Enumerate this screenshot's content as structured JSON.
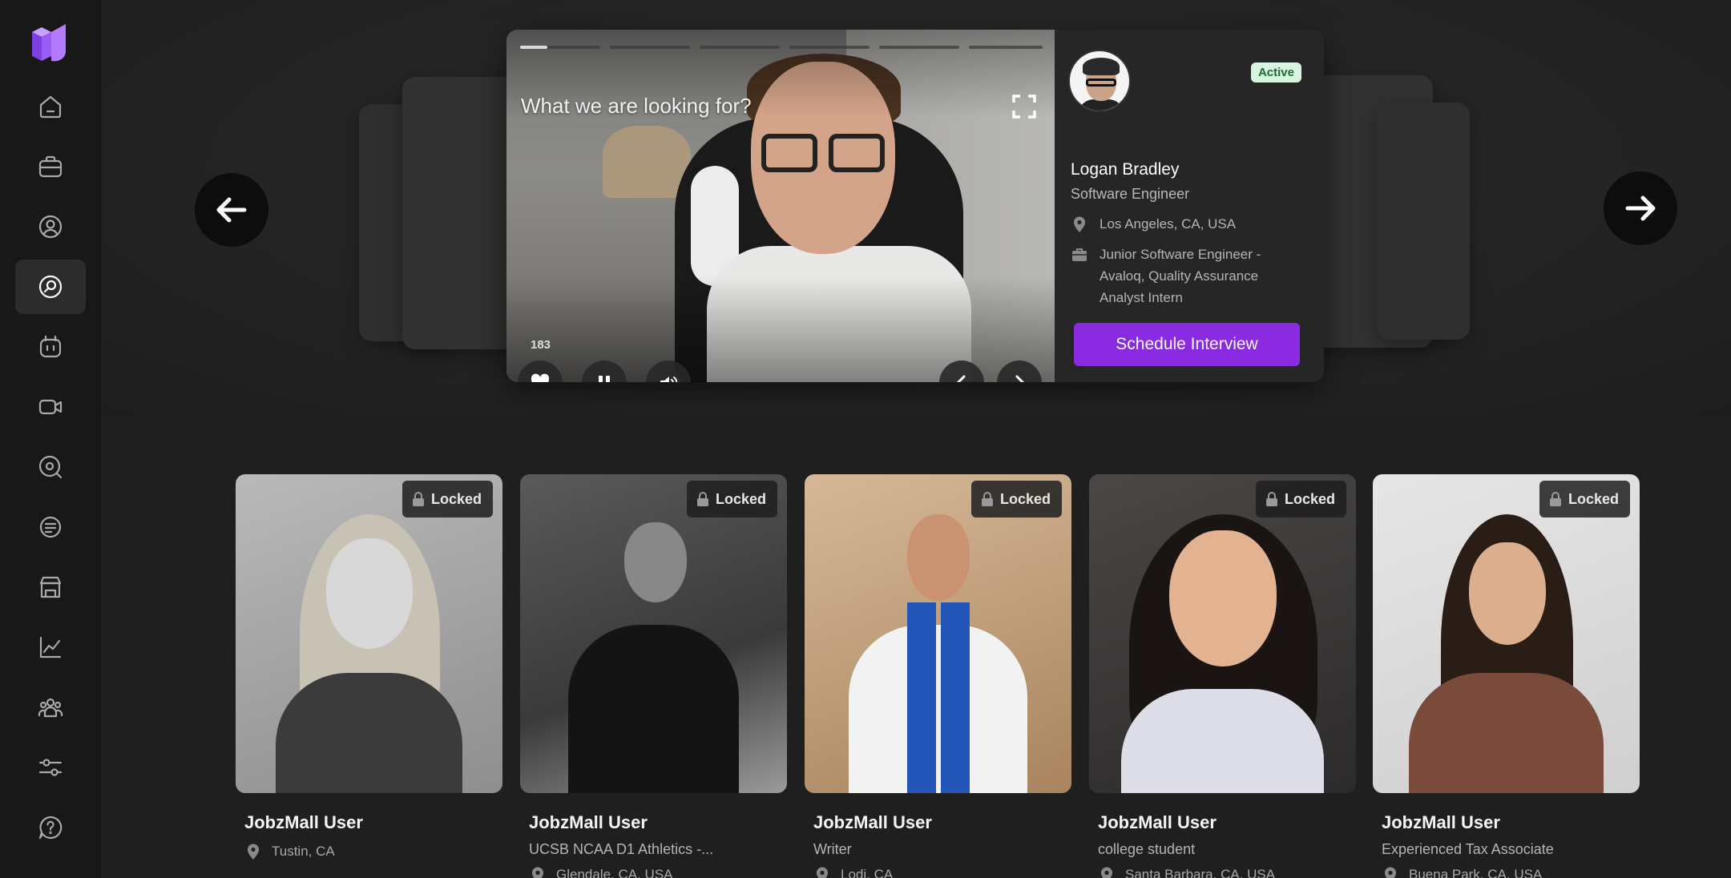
{
  "sidebar": {
    "items": [
      {
        "icon": "home-icon",
        "active": false
      },
      {
        "icon": "briefcase-icon",
        "active": false
      },
      {
        "icon": "user-circle-icon",
        "active": false
      },
      {
        "icon": "search-icon",
        "active": true
      },
      {
        "icon": "calendar-icon",
        "active": false
      },
      {
        "icon": "video-icon",
        "active": false
      },
      {
        "icon": "search-analytics-icon",
        "active": false
      },
      {
        "icon": "document-icon",
        "active": false
      },
      {
        "icon": "store-icon",
        "active": false
      },
      {
        "icon": "chart-line-icon",
        "active": false
      },
      {
        "icon": "team-icon",
        "active": false
      },
      {
        "icon": "settings-sliders-icon",
        "active": false
      },
      {
        "icon": "help-chat-icon",
        "active": false
      }
    ]
  },
  "featured": {
    "video_title": "What we are looking for?",
    "like_count": "183",
    "progress_segments": 6,
    "status": "Active",
    "name": "Logan Bradley",
    "title": "Software Engineer",
    "location": "Los Angeles, CA, USA",
    "experience": "Junior Software Engineer - Avaloq, Quality Assurance Analyst Intern",
    "cta_label": "Schedule Interview"
  },
  "candidates": [
    {
      "lock_label": "Locked",
      "name": "JobzMall User",
      "subtitle": "",
      "location": "Tustin, CA"
    },
    {
      "lock_label": "Locked",
      "name": "JobzMall User",
      "subtitle": "UCSB NCAA D1 Athletics -...",
      "location": "Glendale, CA, USA"
    },
    {
      "lock_label": "Locked",
      "name": "JobzMall User",
      "subtitle": "Writer",
      "location": "Lodi, CA"
    },
    {
      "lock_label": "Locked",
      "name": "JobzMall User",
      "subtitle": "college student",
      "location": "Santa Barbara, CA, USA"
    },
    {
      "lock_label": "Locked",
      "name": "JobzMall User",
      "subtitle": "Experienced Tax Associate",
      "location": "Buena Park, CA, USA"
    }
  ],
  "colors": {
    "accent": "#8a2be2",
    "active_badge_bg": "#d8f5e0",
    "background": "#1f1f1f"
  }
}
